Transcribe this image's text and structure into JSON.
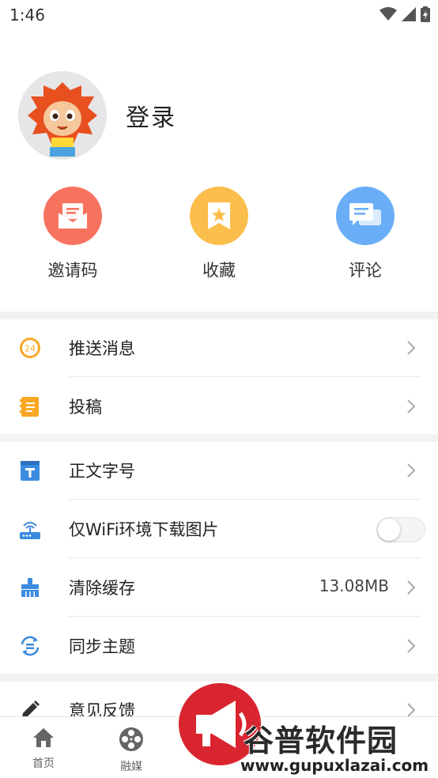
{
  "status_bar": {
    "time": "1:46"
  },
  "profile": {
    "login_label": "登录"
  },
  "quick_actions": [
    {
      "label": "邀请码",
      "color": "#F8735F"
    },
    {
      "label": "收藏",
      "color": "#FBBE4C"
    },
    {
      "label": "评论",
      "color": "#6AAEF7"
    }
  ],
  "menu_group1": [
    {
      "label": "推送消息",
      "icon": "clock-24-icon"
    },
    {
      "label": "投稿",
      "icon": "notebook-icon"
    }
  ],
  "menu_group2": [
    {
      "label": "正文字号",
      "icon": "font-size-icon"
    },
    {
      "label": "仅WiFi环境下载图片",
      "icon": "wifi-router-icon",
      "toggle": false
    },
    {
      "label": "清除缓存",
      "icon": "broom-icon",
      "value": "13.08MB"
    },
    {
      "label": "同步主题",
      "icon": "sync-icon"
    }
  ],
  "menu_group3": [
    {
      "label": "意见反馈",
      "icon": "pencil-icon"
    }
  ],
  "tab_bar": [
    {
      "label": "首页"
    },
    {
      "label": "融媒"
    }
  ],
  "watermark": {
    "text": "谷普软件园",
    "url": "www.gupuxlazai.com"
  }
}
